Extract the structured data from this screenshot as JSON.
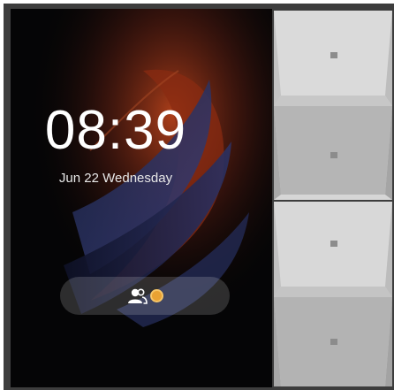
{
  "lock_screen": {
    "time": "08:39",
    "date": "Jun 22  Wednesday",
    "status_icons": [
      "users-icon",
      "coin-icon"
    ]
  },
  "side_panel": {
    "keys": [
      {
        "name": "key-1",
        "indicator": "square"
      },
      {
        "name": "key-2",
        "indicator": "square"
      },
      {
        "name": "key-3",
        "indicator": "square"
      },
      {
        "name": "key-4",
        "indicator": "square"
      }
    ]
  },
  "colors": {
    "screen_background": "#050506",
    "text": "#ffffff",
    "panel_light": "#d9d9d9",
    "panel_dark": "#b6b6b6",
    "coin": "#e9a233"
  }
}
